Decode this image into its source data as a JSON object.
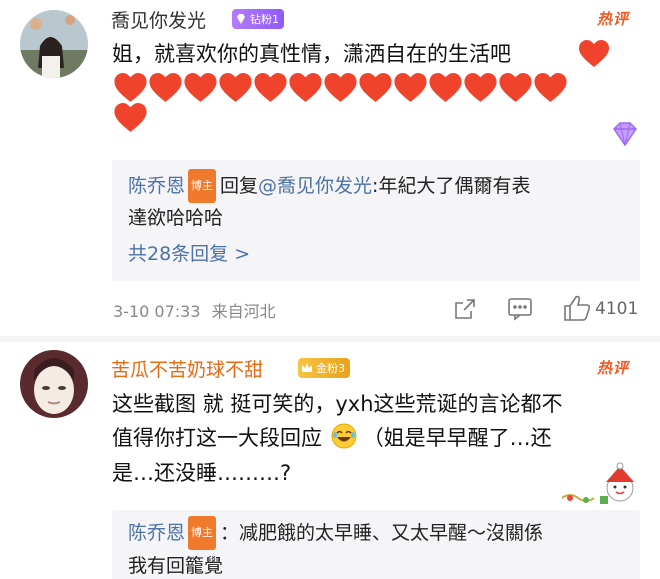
{
  "comments": [
    {
      "username": "喬见你发光",
      "fan_badge": "钻粉1",
      "hot_label": "热评",
      "text": "姐，就喜欢你的真性情，潇洒自在的生活吧",
      "heart_count": 14,
      "reply": {
        "author": "陈乔恩",
        "author_badge": "博主",
        "prefix": "回复",
        "mention": "@喬见你发光",
        "text_line1": ":年紀大了偶爾有表",
        "text_line2": "達欲哈哈哈",
        "more": "共28条回复 >"
      },
      "time": "3-10 07:33",
      "source": "来自河北",
      "likes": "4101"
    },
    {
      "username": "苦瓜不苦奶球不甜",
      "fan_badge": "金粉3",
      "hot_label": "热评",
      "text_line1": "这些截图 就 挺可笑的，yxh这些荒诞的言论都不",
      "text_line2": "值得你打这一大段回应",
      "text_line2b": "（姐是早早醒了…还",
      "text_line3": "是…还没睡………?",
      "reply": {
        "author": "陈乔恩",
        "author_badge": "博主",
        "text_line1": "：减肥餓的太早睡、又太早醒～沒關係",
        "text_line2": "我有回籠覺"
      }
    }
  ],
  "colors": {
    "accent_name": "#e86a12",
    "link": "#4d72a7",
    "hot": "#f05a22",
    "heart": "#f0432b"
  }
}
